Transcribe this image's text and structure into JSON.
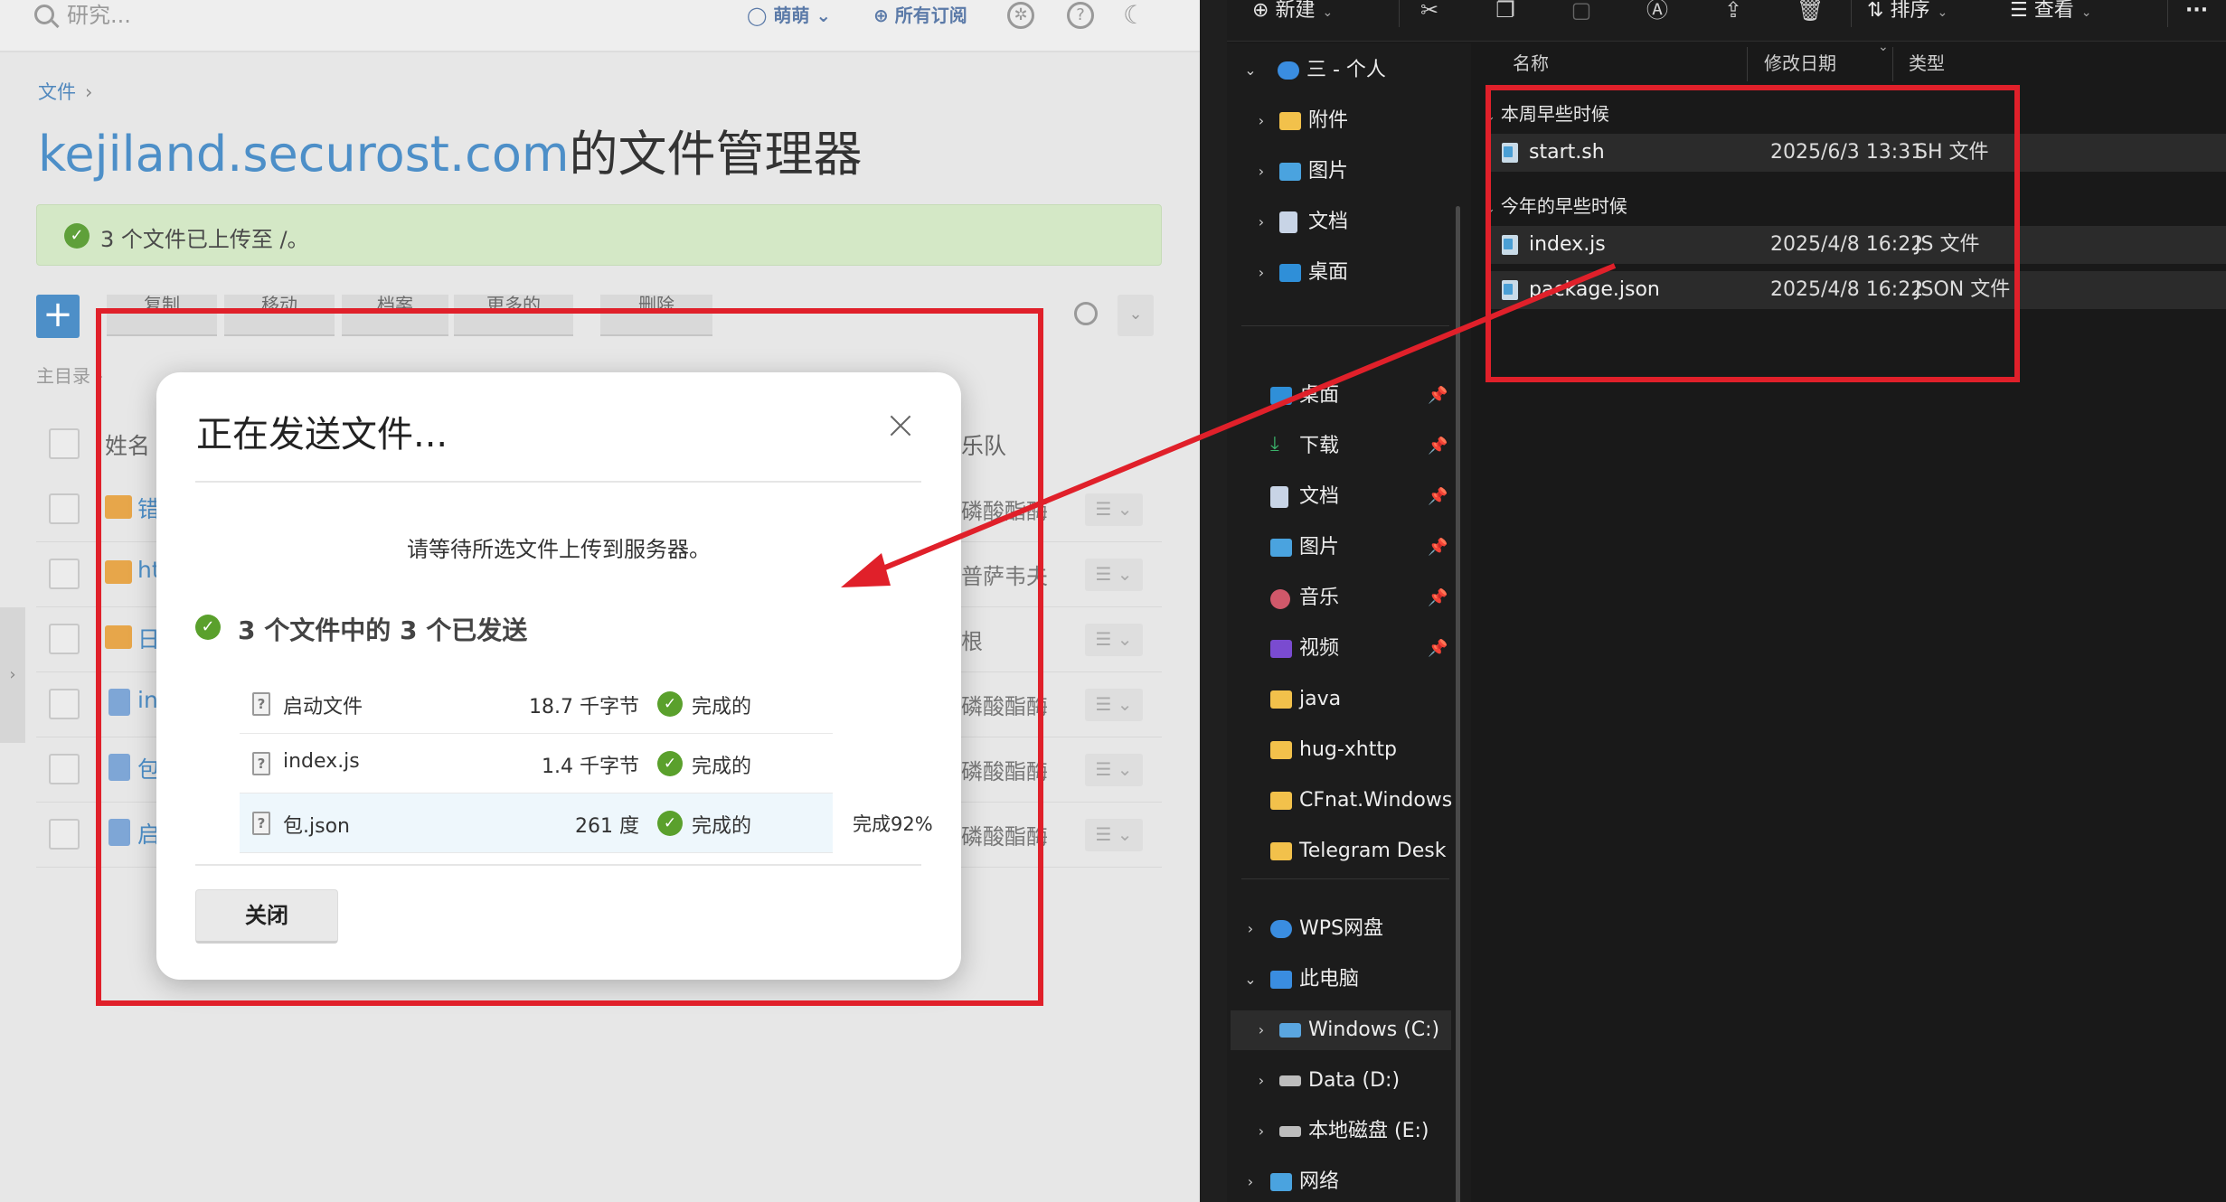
{
  "web": {
    "search_placeholder": "研究...",
    "user_label": "萌萌",
    "subscription_label": "所有订阅",
    "breadcrumb": "文件",
    "title_domain": "kejiland.securost.com",
    "title_suffix": "的文件管理器",
    "notice": "3 个文件已上传至 /。",
    "toolbar": [
      "复制",
      "移动",
      "档案",
      "更多的",
      "删除"
    ],
    "home_crumb": "主目录",
    "columns": {
      "name": "姓名",
      "band": "乐队"
    },
    "rows": [
      {
        "name": "错",
        "band": "磷酸酯酶",
        "kind": "folder"
      },
      {
        "name": "ht",
        "band": "普萨韦夫",
        "kind": "folder"
      },
      {
        "name": "日",
        "band": "根",
        "kind": "folder"
      },
      {
        "name": "in",
        "band": "磷酸酯酶",
        "kind": "doc"
      },
      {
        "name": "包",
        "band": "磷酸酯酶",
        "kind": "doc"
      },
      {
        "name": "启",
        "band": "磷酸酯酶",
        "kind": "doc"
      }
    ]
  },
  "dialog": {
    "title": "正在发送文件...",
    "message": "请等待所选文件上传到服务器。",
    "summary": "3 个文件中的 3 个已发送",
    "files": [
      {
        "name": "启动文件",
        "size": "18.7 千字节",
        "status": "完成的"
      },
      {
        "name": "index.js",
        "size": "1.4 千字节",
        "status": "完成的"
      },
      {
        "name": "包.json",
        "size": "261 度",
        "status": "完成的"
      }
    ],
    "progress_text": "完成92%",
    "progress_percent": 92,
    "close_label": "关闭"
  },
  "explorer": {
    "cmd": {
      "new": "新建",
      "sort": "排序",
      "view": "查看",
      "more": "···"
    },
    "nav": {
      "onedrive": "三 - 个人",
      "onedrive_children": [
        "附件",
        "图片",
        "文档",
        "桌面"
      ],
      "quick": [
        "桌面",
        "下载",
        "文档",
        "图片",
        "音乐",
        "视频",
        "java",
        "hug-xhttp",
        "CFnat.Windows",
        "Telegram Desk"
      ],
      "wps": "WPS网盘",
      "pc": "此电脑",
      "drives": [
        "Windows (C:)",
        "Data (D:)",
        "本地磁盘 (E:)"
      ],
      "network": "网络"
    },
    "columns": {
      "name": "名称",
      "date": "修改日期",
      "type": "类型"
    },
    "groups": [
      {
        "label": "本周早些时候",
        "files": [
          {
            "name": "start.sh",
            "date": "2025/6/3 13:31",
            "type": "SH 文件"
          }
        ]
      },
      {
        "label": "今年的早些时候",
        "files": [
          {
            "name": "index.js",
            "date": "2025/4/8 16:22",
            "type": "JS 文件"
          },
          {
            "name": "package.json",
            "date": "2025/4/8 16:22",
            "type": "JSON 文件"
          }
        ]
      }
    ]
  },
  "annotation_color": "#e0202a"
}
